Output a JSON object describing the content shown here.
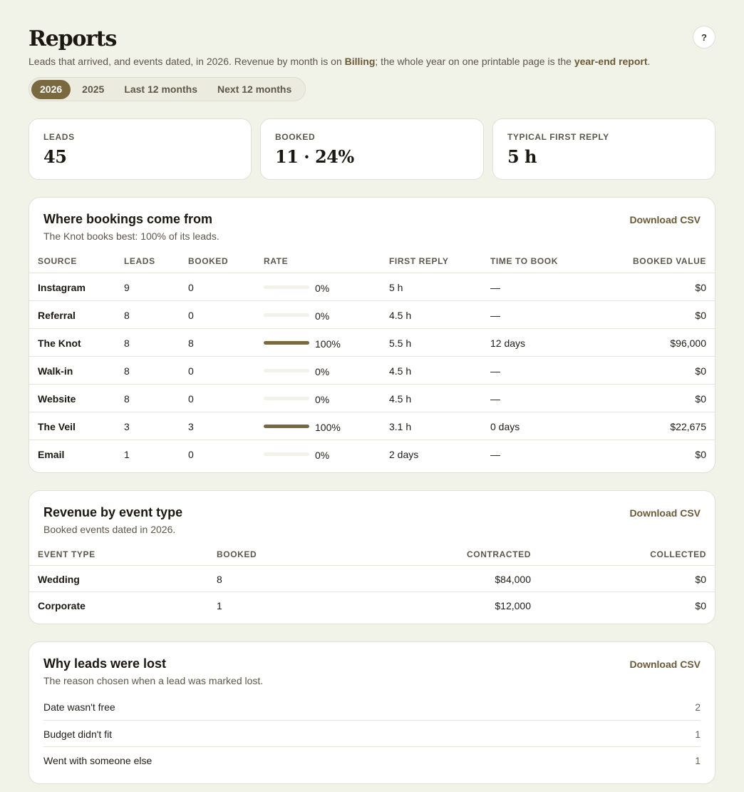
{
  "header": {
    "title": "Reports",
    "help_label": "?",
    "subtitle_a": "Leads that arrived, and events dated, in 2026. Revenue by month is on ",
    "subtitle_billing": "Billing",
    "subtitle_b": "; the whole year on one printable page is the ",
    "subtitle_report": "year-end report",
    "subtitle_c": "."
  },
  "range_tabs": [
    "2026",
    "2025",
    "Last 12 months",
    "Next 12 months"
  ],
  "active_range": "2026",
  "stats": [
    {
      "label": "LEADS",
      "value": "45"
    },
    {
      "label": "BOOKED",
      "value": "11 · 24%"
    },
    {
      "label": "TYPICAL FIRST REPLY",
      "value": "5 h"
    }
  ],
  "sources": {
    "title": "Where bookings come from",
    "subtitle": "The Knot books best: 100% of its leads.",
    "download_label": "Download CSV",
    "columns": [
      "SOURCE",
      "LEADS",
      "BOOKED",
      "RATE",
      "FIRST REPLY",
      "TIME TO BOOK",
      "BOOKED VALUE"
    ],
    "rows": [
      {
        "source": "Instagram",
        "leads": "9",
        "booked": "0",
        "rate": 0,
        "rate_label": "0%",
        "first_reply": "5 h",
        "time_to_book": "—",
        "value": "$0"
      },
      {
        "source": "Referral",
        "leads": "8",
        "booked": "0",
        "rate": 0,
        "rate_label": "0%",
        "first_reply": "4.5 h",
        "time_to_book": "—",
        "value": "$0"
      },
      {
        "source": "The Knot",
        "leads": "8",
        "booked": "8",
        "rate": 100,
        "rate_label": "100%",
        "first_reply": "5.5 h",
        "time_to_book": "12 days",
        "value": "$96,000"
      },
      {
        "source": "Walk-in",
        "leads": "8",
        "booked": "0",
        "rate": 0,
        "rate_label": "0%",
        "first_reply": "4.5 h",
        "time_to_book": "—",
        "value": "$0"
      },
      {
        "source": "Website",
        "leads": "8",
        "booked": "0",
        "rate": 0,
        "rate_label": "0%",
        "first_reply": "4.5 h",
        "time_to_book": "—",
        "value": "$0"
      },
      {
        "source": "The Veil",
        "leads": "3",
        "booked": "3",
        "rate": 100,
        "rate_label": "100%",
        "first_reply": "3.1 h",
        "time_to_book": "0 days",
        "value": "$22,675"
      },
      {
        "source": "Email",
        "leads": "1",
        "booked": "0",
        "rate": 0,
        "rate_label": "0%",
        "first_reply": "2 days",
        "time_to_book": "—",
        "value": "$0"
      }
    ]
  },
  "event_types": {
    "title": "Revenue by event type",
    "subtitle": "Booked events dated in 2026.",
    "download_label": "Download CSV",
    "columns": [
      "EVENT TYPE",
      "BOOKED",
      "CONTRACTED",
      "COLLECTED"
    ],
    "rows": [
      {
        "type": "Wedding",
        "booked": "8",
        "contracted": "$84,000",
        "collected": "$0"
      },
      {
        "type": "Corporate",
        "booked": "1",
        "contracted": "$12,000",
        "collected": "$0"
      }
    ]
  },
  "lost": {
    "title": "Why leads were lost",
    "subtitle": "The reason chosen when a lead was marked lost.",
    "download_label": "Download CSV",
    "rows": [
      {
        "reason": "Date wasn't free",
        "count": "2"
      },
      {
        "reason": "Budget didn't fit",
        "count": "1"
      },
      {
        "reason": "Went with someone else",
        "count": "1"
      }
    ]
  },
  "colors": {
    "accent": "#7a6840",
    "link": "#6b5a37",
    "background": "#f1f2e8"
  }
}
